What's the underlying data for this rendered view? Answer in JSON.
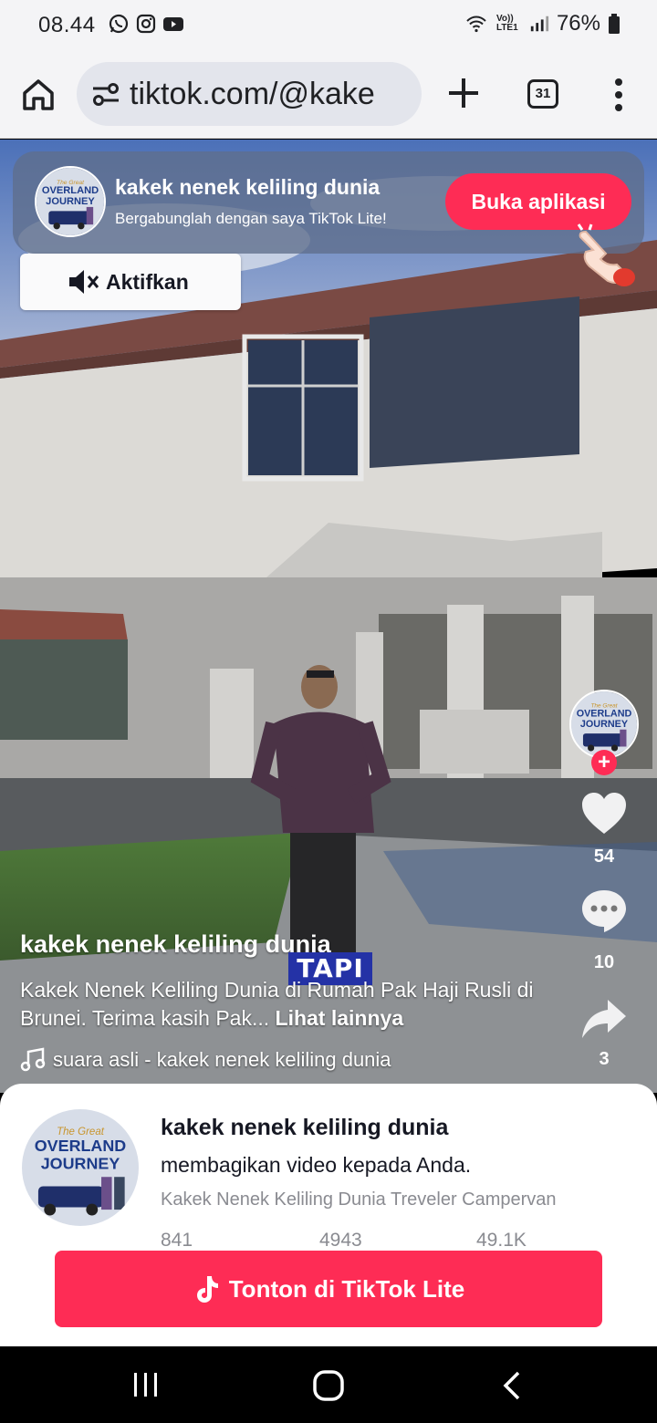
{
  "status_bar": {
    "time": "08.44",
    "network": "Vo)) LTE1",
    "battery": "76%",
    "icons": [
      "whatsapp-icon",
      "instagram-icon",
      "youtube-icon",
      "wifi-icon",
      "signal-icon",
      "battery-icon"
    ]
  },
  "browser": {
    "url": "tiktok.com/@kake",
    "tab_count": "31",
    "icons": [
      "home-icon",
      "site-settings-icon",
      "new-tab-plus-icon",
      "tab-switcher-icon",
      "more-vert-icon"
    ]
  },
  "promo": {
    "title": "kakek nenek keliling dunia",
    "subtitle": "Bergabunglah dengan saya TikTok Lite!",
    "open_app_label": "Buka aplikasi"
  },
  "unmute": {
    "label": "Aktifkan"
  },
  "video": {
    "username": "kakek nenek keliling dunia",
    "overlay_text": "TAPI",
    "caption": "Kakek Nenek Keliling Dunia di Rumah Pak Haji Rusli di Brunei. Terima kasih Pak...",
    "see_more": "Lihat lainnya",
    "music": "suara asli - kakek nenek keliling dunia"
  },
  "actions": {
    "likes": "54",
    "comments": "10",
    "shares": "3"
  },
  "sheet": {
    "name": "kakek nenek keliling dunia",
    "shared_text": "membagikan video kepada Anda.",
    "bio": "Kakek Nenek Keliling Dunia Treveler Campervan",
    "stats": [
      "841",
      "4943",
      "49.1K"
    ],
    "watch_label": "Tonton di TikTok Lite"
  },
  "avatar_logo": {
    "line1": "The Great",
    "line2": "OVERLAND",
    "line3": "JOURNEY"
  },
  "colors": {
    "accent": "#fe2c55",
    "browser_bg": "#f4f4f6",
    "url_bg": "#e3e5ec"
  }
}
